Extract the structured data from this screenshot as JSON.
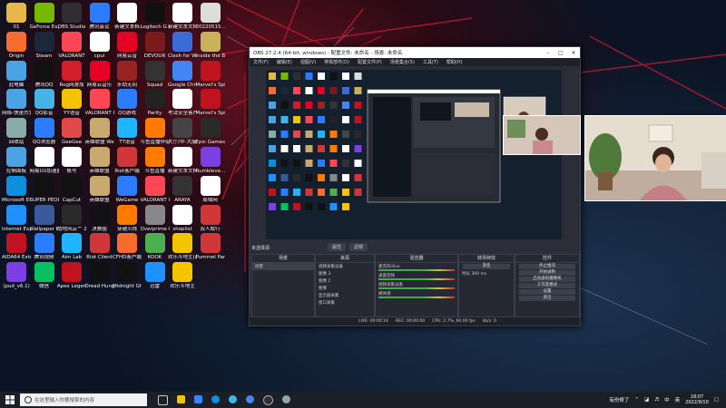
{
  "desktop": {
    "icons": [
      {
        "label": "01",
        "color": "#e6b84a"
      },
      {
        "label": "GeForce Experience",
        "color": "#76b900"
      },
      {
        "label": "OBS Studio",
        "color": "#302e31"
      },
      {
        "label": "腾讯会议",
        "color": "#2b7cff"
      },
      {
        "label": "新建文本档",
        "color": "#ffffff"
      },
      {
        "label": "Logitech G HUB",
        "color": "#101010"
      },
      {
        "label": "新建文本文档",
        "color": "#ffffff"
      },
      {
        "label": "20220515...",
        "color": "#ddd"
      },
      {
        "label": "Origin",
        "color": "#f56c2d"
      },
      {
        "label": "Steam",
        "color": "#1b2838"
      },
      {
        "label": "VALORANT",
        "color": "#ff4655"
      },
      {
        "label": "cpui",
        "color": "#ffffff"
      },
      {
        "label": "网易云音",
        "color": "#e60026"
      },
      {
        "label": "DEVOUR",
        "color": "#7a1a1a"
      },
      {
        "label": "Clash for Windows",
        "color": "#3b6bd6"
      },
      {
        "label": "Inside the Backrooms",
        "color": "#c9b25a"
      },
      {
        "label": "此电脑",
        "color": "#4ba3e3"
      },
      {
        "label": "腾讯QQ",
        "color": "#111"
      },
      {
        "label": "Rog网游加",
        "color": "#d21e2b"
      },
      {
        "label": "网易云音乐",
        "color": "#e60026"
      },
      {
        "label": "永劫无间",
        "color": "#992222"
      },
      {
        "label": "Squad",
        "color": "#333"
      },
      {
        "label": "Google Chrome",
        "color": "#4285f4"
      },
      {
        "label": "Marvel's Spider-M...",
        "color": "#c1121f"
      },
      {
        "label": "网络-快速方式",
        "color": "#4ba3e3"
      },
      {
        "label": "QQ影音",
        "color": "#46b3e6"
      },
      {
        "label": "YY语音",
        "color": "#f5c400"
      },
      {
        "label": "VALORANT Influenc...",
        "color": "#ff4655"
      },
      {
        "label": "QQ游戏",
        "color": "#2b7cff"
      },
      {
        "label": "Parity",
        "color": "#222"
      },
      {
        "label": "考试安全客户端",
        "color": "#ffffff"
      },
      {
        "label": "Marvel's Spider-M...",
        "color": "#c1121f"
      },
      {
        "label": "回收站",
        "color": "#8aa"
      },
      {
        "label": "QQ浏览器",
        "color": "#2b7cff"
      },
      {
        "label": "GeeGee",
        "color": "#e14a4a"
      },
      {
        "label": "英雄联盟 WeGame版",
        "color": "#c8aa6e"
      },
      {
        "label": "TT语音",
        "color": "#1fb6ff"
      },
      {
        "label": "斗鱼直播伴侣",
        "color": "#ff7a00"
      },
      {
        "label": "大厅(中-大服)",
        "color": "#444"
      },
      {
        "label": "Epic Games Launcher",
        "color": "#2a2a2a"
      },
      {
        "label": "控制面板",
        "color": "#4ba3e3"
      },
      {
        "label": "网易UU加速器",
        "color": "#ffffff"
      },
      {
        "label": "账号",
        "color": "#ffffff"
      },
      {
        "label": "英雄联盟",
        "color": "#c8aa6e"
      },
      {
        "label": "Riot客户端",
        "color": "#d13639"
      },
      {
        "label": "斗鱼直播",
        "color": "#ff7a00"
      },
      {
        "label": "新建文本文档",
        "color": "#ffffff"
      },
      {
        "label": "Rumbleve...",
        "color": "#7b3fe4"
      },
      {
        "label": "Microsoft Edge",
        "color": "#0c8fdd"
      },
      {
        "label": "SUPER PEOPLE CBT",
        "color": "#111"
      },
      {
        "label": "CapCut",
        "color": "#111"
      },
      {
        "label": "英雄联盟",
        "color": "#c8aa6e"
      },
      {
        "label": "WeGame",
        "color": "#2b7cff"
      },
      {
        "label": "VALORANT Influenc...",
        "color": "#ff4655"
      },
      {
        "label": "ARAYA",
        "color": "#333"
      },
      {
        "label": "局域网",
        "color": "#ffffff"
      },
      {
        "label": "Internet Explorer",
        "color": "#1e90ff"
      },
      {
        "label": "Wallpaper Engine: ...",
        "color": "#3a5a9a"
      },
      {
        "label": "战地风云™ 2042",
        "color": "#2a2a2a"
      },
      {
        "label": "决赛圈",
        "color": "#111"
      },
      {
        "label": "穿越火线",
        "color": "#ff7a00"
      },
      {
        "label": "Overprime CBT Client",
        "color": "#888"
      },
      {
        "label": "shoplist",
        "color": "#ffffff"
      },
      {
        "label": "双人成行",
        "color": "#d13639"
      },
      {
        "label": "AIDA64 Extreme",
        "color": "#c1121f"
      },
      {
        "label": "腾讯视频",
        "color": "#2b7cff"
      },
      {
        "label": "Aim Lab",
        "color": "#1fb6ff"
      },
      {
        "label": "Riot Client",
        "color": "#d13639"
      },
      {
        "label": "CFHD客户端 (放大版)",
        "color": "#f56c2d"
      },
      {
        "label": "KOOK",
        "color": "#4caf50"
      },
      {
        "label": "欢乐斗地主(游戏版)",
        "color": "#f5c400"
      },
      {
        "label": "Pummel Party",
        "color": "#d13639"
      },
      {
        "label": "(pud_v6.1)",
        "color": "#7b3fe4"
      },
      {
        "label": "微信",
        "color": "#07c160"
      },
      {
        "label": "Apex Legends",
        "color": "#c1121f"
      },
      {
        "label": "Dread Hunger",
        "color": "#111"
      },
      {
        "label": "Midnight Ghost Hunt",
        "color": "#111"
      },
      {
        "label": "迅雷",
        "color": "#1e90ff"
      },
      {
        "label": "欢乐斗地主",
        "color": "#f5c400"
      }
    ]
  },
  "obs": {
    "title": "OBS 27.2.4 (64-bit, windows) - 配置文件: 未命名 - 场景: 未命名",
    "menu": [
      "文件(F)",
      "编辑(E)",
      "视图(V)",
      "停靠部件(D)",
      "配置文件(P)",
      "场景集合(S)",
      "工具(T)",
      "帮助(H)"
    ],
    "no_source": "未选择源",
    "props_btn": "属性",
    "filters_btn": "滤镜",
    "docks": {
      "scenes": {
        "title": "场景",
        "items": [
          "场景"
        ]
      },
      "sources": {
        "title": "来源",
        "items": [
          "视频采集设备",
          "图像 3",
          "图像 2",
          "图像",
          "显示器采集",
          "窗口采集"
        ]
      },
      "mixer": {
        "title": "混音器",
        "items": [
          "麦克风/Aux",
          "桌面音频",
          "视频采集设备",
          "媒体源"
        ]
      },
      "transitions": {
        "title": "转场特效",
        "mode": "渐变",
        "duration_label": "时长",
        "duration": "300 ms"
      },
      "controls": {
        "title": "控件",
        "buttons": [
          "停止推流",
          "开始录制",
          "启动虚拟摄像机",
          "工作室模式",
          "设置",
          "退出"
        ]
      }
    },
    "statusbar": {
      "live": "LIVE: 00:00:14",
      "rec": "REC: 00:00:00",
      "cpu": "CPU: 2.7%, 60.00 fps",
      "bitrate": "kb/s: 0"
    }
  },
  "taskbar": {
    "search_placeholder": "在这里输入你要搜索的内容",
    "notice": "有份修了",
    "weather": "",
    "lang": "中",
    "ime": "英",
    "time": "18:07",
    "date": "2022/9/10"
  }
}
